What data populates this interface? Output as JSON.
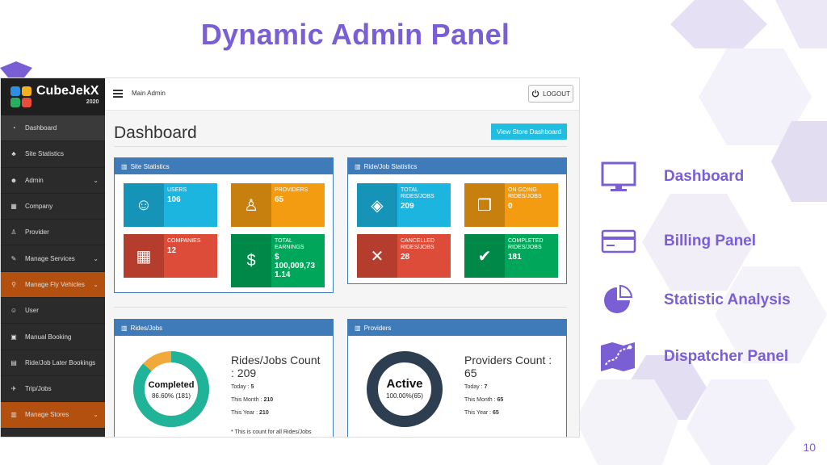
{
  "slide": {
    "title": "Dynamic Admin Panel",
    "page_number": "10"
  },
  "colors": {
    "accent": "#7a5fd4",
    "sidebar_bg": "#2b2b2b",
    "sidebar_active": "#b3500f",
    "panel_header": "#3e7bb8"
  },
  "app": {
    "logo_name": "CubeJekX",
    "logo_year": "2020",
    "crumb": "Main Admin",
    "logout_label": "LOGOUT",
    "page_title": "Dashboard",
    "store_button": "View Store Dashboard"
  },
  "sidebar": {
    "items": [
      {
        "label": "Dashboard",
        "icon": "gauge-icon",
        "chevron": false
      },
      {
        "label": "Site Statistics",
        "icon": "sitemap-icon",
        "chevron": false
      },
      {
        "label": "Admin",
        "icon": "admin-icon",
        "chevron": true
      },
      {
        "label": "Company",
        "icon": "building-icon",
        "chevron": false
      },
      {
        "label": "Provider",
        "icon": "person-icon",
        "chevron": false
      },
      {
        "label": "Manage Services",
        "icon": "wrench-icon",
        "chevron": true
      },
      {
        "label": "Manage Fly Vehicles",
        "icon": "map-pin-icon",
        "chevron": true
      },
      {
        "label": "User",
        "icon": "users-icon",
        "chevron": false
      },
      {
        "label": "Manual Booking",
        "icon": "booking-icon",
        "chevron": false
      },
      {
        "label": "Ride/Job Later Bookings",
        "icon": "calendar-icon",
        "chevron": false
      },
      {
        "label": "Trip/Jobs",
        "icon": "trip-icon",
        "chevron": false
      },
      {
        "label": "Manage Stores",
        "icon": "store-icon",
        "chevron": true
      }
    ]
  },
  "site_statistics": {
    "title": "Site Statistics",
    "tiles": [
      {
        "label": "USERS",
        "value": "106",
        "color": "#1cb5e0",
        "icon": "users-icon"
      },
      {
        "label": "PROVIDERS",
        "value": "65",
        "color": "#f39c12",
        "icon": "person-icon"
      },
      {
        "label": "COMPANIES",
        "value": "12",
        "color": "#dd4b39",
        "icon": "building-icon"
      },
      {
        "label": "TOTAL EARNINGS",
        "value": "$ 100,009,73 1.14",
        "color": "#00a65a",
        "icon": "money-icon"
      }
    ]
  },
  "ride_statistics": {
    "title": "Ride/Job Statistics",
    "tiles": [
      {
        "label": "TOTAL RIDES/JOBS",
        "value": "209",
        "color": "#1cb5e0",
        "icon": "cubes-icon"
      },
      {
        "label": "ON GOING RIDES/JOBS",
        "value": "0",
        "color": "#f39c12",
        "icon": "copy-icon"
      },
      {
        "label": "CANCELLED RIDES/JOBS",
        "value": "28",
        "color": "#dd4b39",
        "icon": "cancel-icon"
      },
      {
        "label": "COMPLETED RIDES/JOBS",
        "value": "181",
        "color": "#00a65a",
        "icon": "check-icon"
      }
    ]
  },
  "rides_panel": {
    "title": "Rides/Jobs",
    "ring_label": "Completed",
    "ring_value": "86.60% (181)",
    "completed_fraction": 0.866,
    "count_title_1": "Rides/Jobs Count",
    "count_title_2": ": 209",
    "today": "5",
    "month": "210",
    "year": "210",
    "today_label": "Today :",
    "month_label": "This Month :",
    "year_label": "This Year :",
    "note": "* This is count for all Rides/Jobs"
  },
  "providers_panel": {
    "title": "Providers",
    "ring_label": "Active",
    "ring_value": "100.00%(65)",
    "count_title_1": "Providers Count :",
    "count_title_2": "65",
    "today": "7",
    "month": "65",
    "year": "65",
    "today_label": "Today :",
    "month_label": "This Month :",
    "year_label": "This Year :"
  },
  "features": [
    {
      "label": "Dashboard",
      "icon": "monitor-icon"
    },
    {
      "label": "Billing Panel",
      "icon": "credit-card-icon"
    },
    {
      "label": "Statistic Analysis",
      "icon": "pie-chart-icon"
    },
    {
      "label": "Dispatcher Panel",
      "icon": "map-icon"
    }
  ]
}
